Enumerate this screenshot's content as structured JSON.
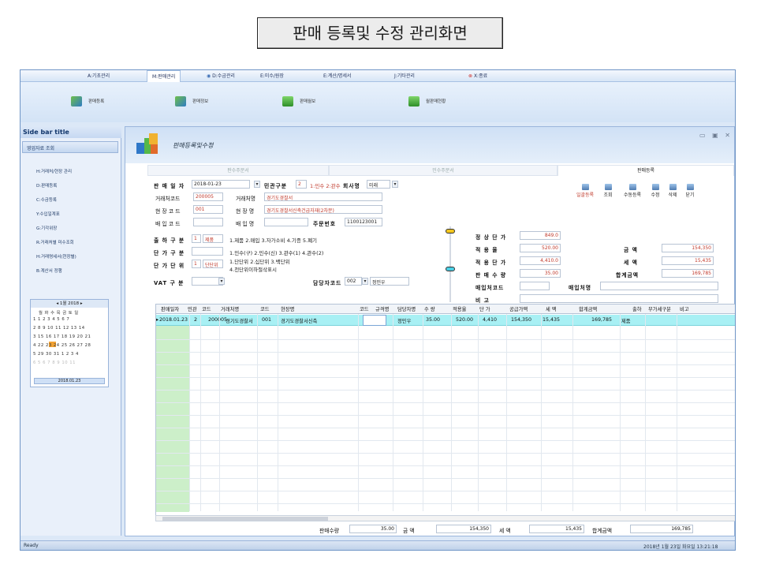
{
  "page_title": "판매 등록및 수정 관리화면",
  "menu_tabs": [
    "A:기초관리",
    "M:판매관리",
    "D:수금관리",
    "E:미수/원장",
    "E:계산/명세서",
    "J:기타관리",
    "X:종료"
  ],
  "ribbon_buttons": [
    "판매등록",
    "판매정보",
    "판매월보",
    "월판매현황"
  ],
  "sidebar": {
    "title": "Side bar title",
    "group": "영업자료 조회",
    "items": [
      "H:거래처/현장 관리",
      "D:판매등록",
      "C:수금등록",
      "Y:수입일계표",
      "G:기각위장",
      "R:거래처별 미수조회",
      "H:거래명세서(현장별)",
      "B:계산서 정행"
    ]
  },
  "calendar": {
    "month": "1월 2018",
    "weekdays": "월 화 수 목 금 토 일",
    "rows": [
      "1  1  2  3  4  5  6  7",
      "2  8  9 10 11 12 13 14",
      "3 15 16 17 18 19 20 21",
      "4 22 23 24 25 26 27 28",
      "5 29 30 31  1  2  3  4",
      "6  5  6  7  8  9 10 11"
    ],
    "selected": "2018.01.23"
  },
  "window": {
    "title": "판매등록및수정",
    "controls": "▭ ▣ ✕",
    "tabs": [
      "판수주문서",
      "민수주문서",
      "판매등록"
    ]
  },
  "form": {
    "sale_date_label": "판 매 일 자",
    "sale_date": "2018-01-23",
    "gov_label": "민관구분",
    "gov_value": "2",
    "gov_note": "1:민수 2:관수",
    "company_label": "회사명",
    "company_value": "미래",
    "client_code_label": "거래처코드",
    "client_code": "200005",
    "client_name_label": "거래처명",
    "client_name": "경기도경찰서",
    "site_code_label": "현 장 코 드",
    "site_code": "001",
    "site_name_label": "현 장 명",
    "site_name": "경기도경찰서신축건급자재(2차분)",
    "delivery_code_label": "배 입 코 드",
    "delivery_name_label": "배 입 명",
    "order_no_label": "주문번호",
    "order_no": "1100123001",
    "ship_label": "출 하 구 분",
    "ship_code": "1",
    "ship_value": "제품",
    "ship_note": "1.제품 2.매입 3.자가소비 4.기증 5.폐기",
    "price_type_label": "단 가 구 분",
    "price_type_note": "1.민수(구) 2.민수(신) 3.관수(1) 4.관수(2)",
    "price_unit_label": "단 가 단 위",
    "price_unit_code": "1",
    "price_unit_value": "단단위",
    "price_unit_note1": "1.단단위 2.십단위 3.백단위",
    "price_unit_note2": "4.천단위이하절삭표시",
    "vat_label": "VAT 구 분",
    "manager_label": "담당자코드",
    "manager_code": "002",
    "manager_name": "정민우",
    "normal_price_label": "정 상 단 가",
    "normal_price": "849.0",
    "apply_rate_label": "적 용 율",
    "apply_rate": "520.00",
    "apply_price_label": "적 용 단 가",
    "apply_price": "4,410.0",
    "qty_label": "판 매 수 량",
    "qty": "35.00",
    "buyer_code_label": "매입처코드",
    "buyer_name_label": "매입처명",
    "remark_label": "비  고",
    "amount_label": "금  액",
    "amount": "154,350",
    "tax_label": "세  액",
    "tax": "15,435",
    "total_label": "합계금액",
    "total": "169,785"
  },
  "toolbar": [
    "일괄등록",
    "조회",
    "수동등록",
    "수정",
    "삭제",
    "닫기"
  ],
  "grid": {
    "headers": [
      "판매일자",
      "민관",
      "코드",
      "거래처명",
      "코드",
      "현장명",
      "코드",
      "규격명",
      "담당자명",
      "수 량",
      "적용율",
      "단 가",
      "공급가액",
      "세 액",
      "합계금액",
      "출하",
      "부가세구분",
      "비고"
    ],
    "row": [
      "2018.01.23",
      "2",
      "200005",
      "경기도경찰서",
      "001",
      "경기도경찰서신축",
      "",
      "",
      "정민우",
      "35.00",
      "520.00",
      "4,410",
      "154,350",
      "15,435",
      "169,785",
      "제품",
      "",
      ""
    ]
  },
  "totals": {
    "qty_label": "판매수량",
    "qty": "35.00",
    "amount_label": "금  액",
    "amount": "154,350",
    "tax_label": "세  액",
    "tax": "15,435",
    "total_label": "합계금액",
    "total": "169,785"
  },
  "status": {
    "left": "Ready",
    "right": "2018년 1월 23일 화요일 13:21:18"
  }
}
